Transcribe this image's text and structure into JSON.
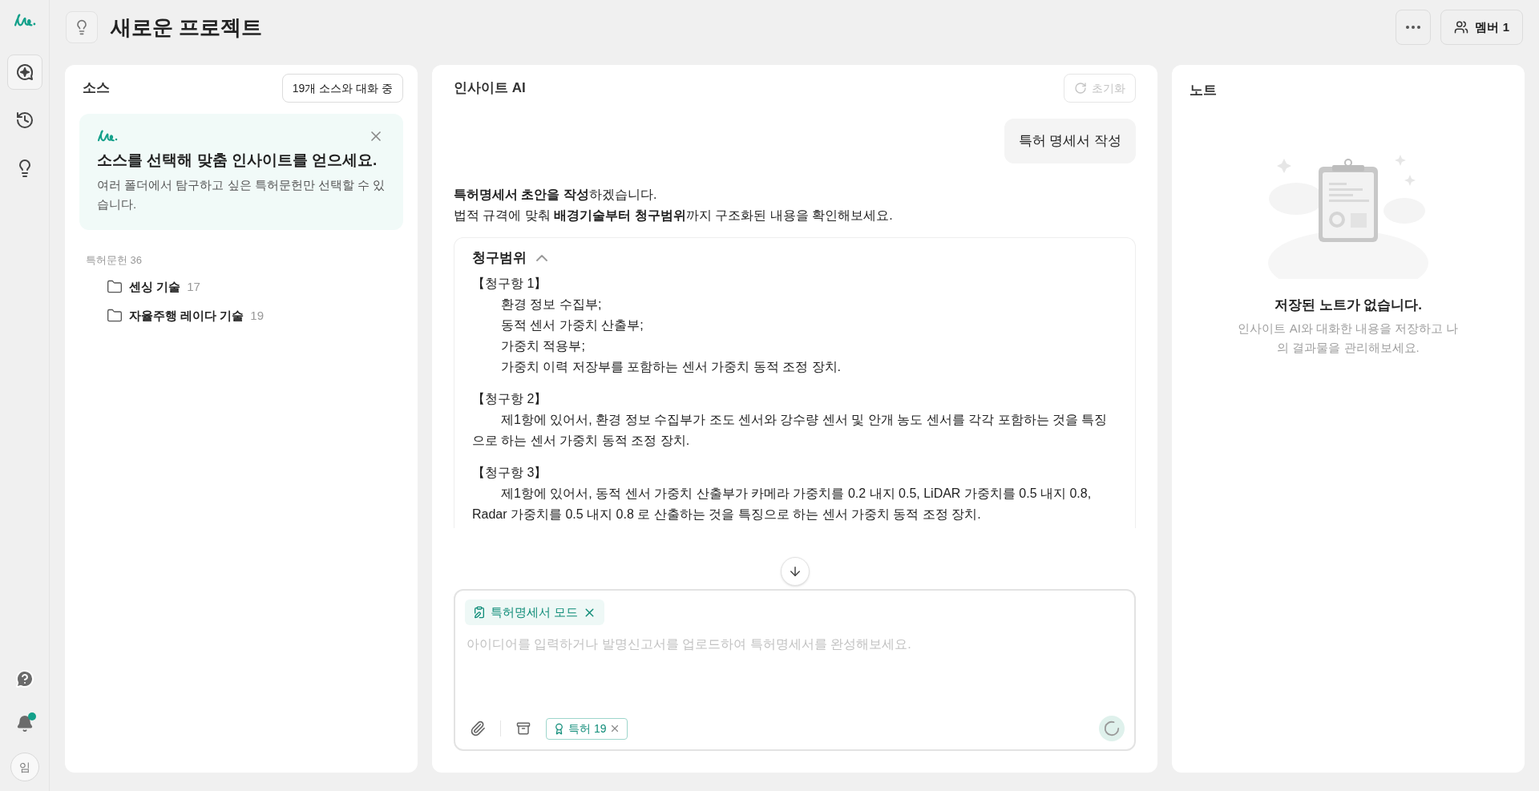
{
  "sidebar": {
    "avatar": "임",
    "notification_unread": true
  },
  "header": {
    "title": "새로운 프로젝트",
    "members_button": "멤버 1"
  },
  "sources": {
    "title": "소스",
    "chat_scope_button": "19개 소스와 대화 중",
    "banner": {
      "title": "소스를 선택해 맞춤 인사이트를 얻으세요.",
      "description": "여러 폴더에서 탐구하고 싶은 특허문헌만 선택할 수 있습니다."
    },
    "group": {
      "label": "특허문헌 36",
      "folders": [
        {
          "name": "센싱 기술",
          "count": "17"
        },
        {
          "name": "자율주행 레이다 기술",
          "count": "19"
        }
      ]
    }
  },
  "insight": {
    "title": "인사이트 AI",
    "reset_button": {
      "label": "초기화",
      "disabled": true
    },
    "user_message": "특허 명세서 작성",
    "assistant_lines": [
      "**특허명세서 초안을 작성**하겠습니다.",
      "법적 규격에 맞춰 **배경기술부터 청구범위**까지 구조화된 내용을 확인해보세요."
    ],
    "section": {
      "title": "청구범위",
      "expanded": true,
      "claims": [
        {
          "title": "【청구항 1】",
          "paragraphs": [
            "환경 정보 수집부;",
            "동적 센서 가중치 산출부;",
            "가중치 적용부;",
            "가중치 이력 저장부를 포함하는 센서 가중치 동적 조정 장치."
          ]
        },
        {
          "title": "【청구항 2】",
          "paragraphs": [
            "제1항에 있어서, 환경 정보 수집부가 조도 센서와 강수량 센서 및 안개 농도 센서를 각각 포함하는 것을 특징으로 하는 센서 가중치 동적 조정 장치."
          ]
        },
        {
          "title": "【청구항 3】",
          "paragraphs": [
            "제1항에 있어서, 동적 센서 가중치 산출부가 카메라 가중치를 0.2 내지 0.5, LiDAR 가중치를 0.5 내지 0.8, Radar 가중치를 0.5 내지 0.8 로 산출하는 것을 특징으로 하는 센서 가중치 동적 조정 장치."
          ]
        }
      ]
    },
    "composer": {
      "mode_chip": "특허명세서 모드",
      "placeholder": "아이디어를 입력하거나 발명신고서를 업로드하여 특허명세서를 완성해보세요.",
      "source_chip": "특허 19"
    }
  },
  "notes": {
    "title": "노트",
    "empty_title": "저장된 노트가 없습니다.",
    "empty_description": "인사이트 AI와 대화한 내용을 저장하고 나의 결과물을 관리해보세요."
  }
}
